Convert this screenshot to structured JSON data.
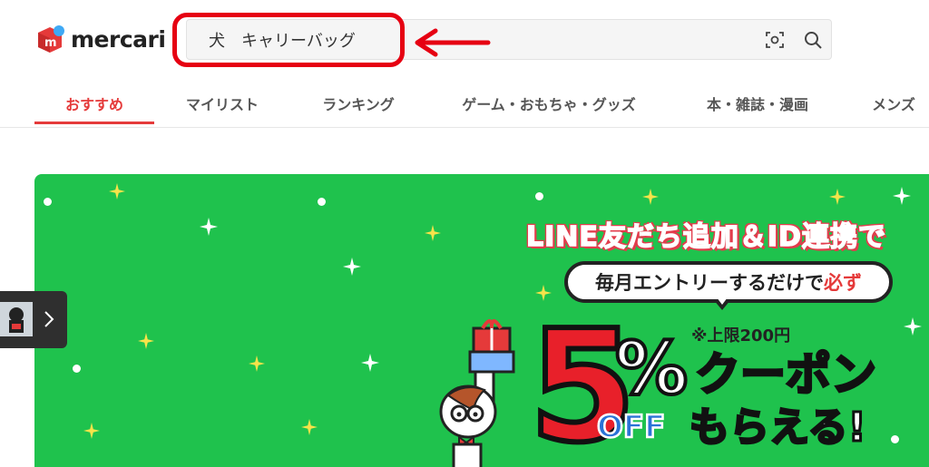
{
  "header": {
    "logo_text": "mercari",
    "search": {
      "value": "犬　キャリーバッグ",
      "placeholder": ""
    },
    "icons": [
      "camera-scan-icon",
      "search-icon"
    ]
  },
  "tabs": [
    {
      "label": "おすすめ",
      "active": true
    },
    {
      "label": "マイリスト",
      "active": false
    },
    {
      "label": "ランキング",
      "active": false
    },
    {
      "label": "ゲーム・おもちゃ・グッズ",
      "active": false
    },
    {
      "label": "本・雑誌・漫画",
      "active": false
    },
    {
      "label": "メンズ",
      "active": false
    }
  ],
  "banner": {
    "headline": "LINE友だち追加＆ID連携で",
    "bubble_pre": "毎月エントリーするだけで",
    "bubble_accent": "必ず",
    "limit_note": "※上限200円",
    "big_number": "5",
    "percent_sign": "%",
    "off_text": "OFF",
    "coupon_text": "クーポン",
    "moraeru_text": "もらえる!"
  },
  "colors": {
    "accent_red": "#e53a3a",
    "banner_green": "#1fc24d",
    "annotation_red": "#e60012"
  }
}
